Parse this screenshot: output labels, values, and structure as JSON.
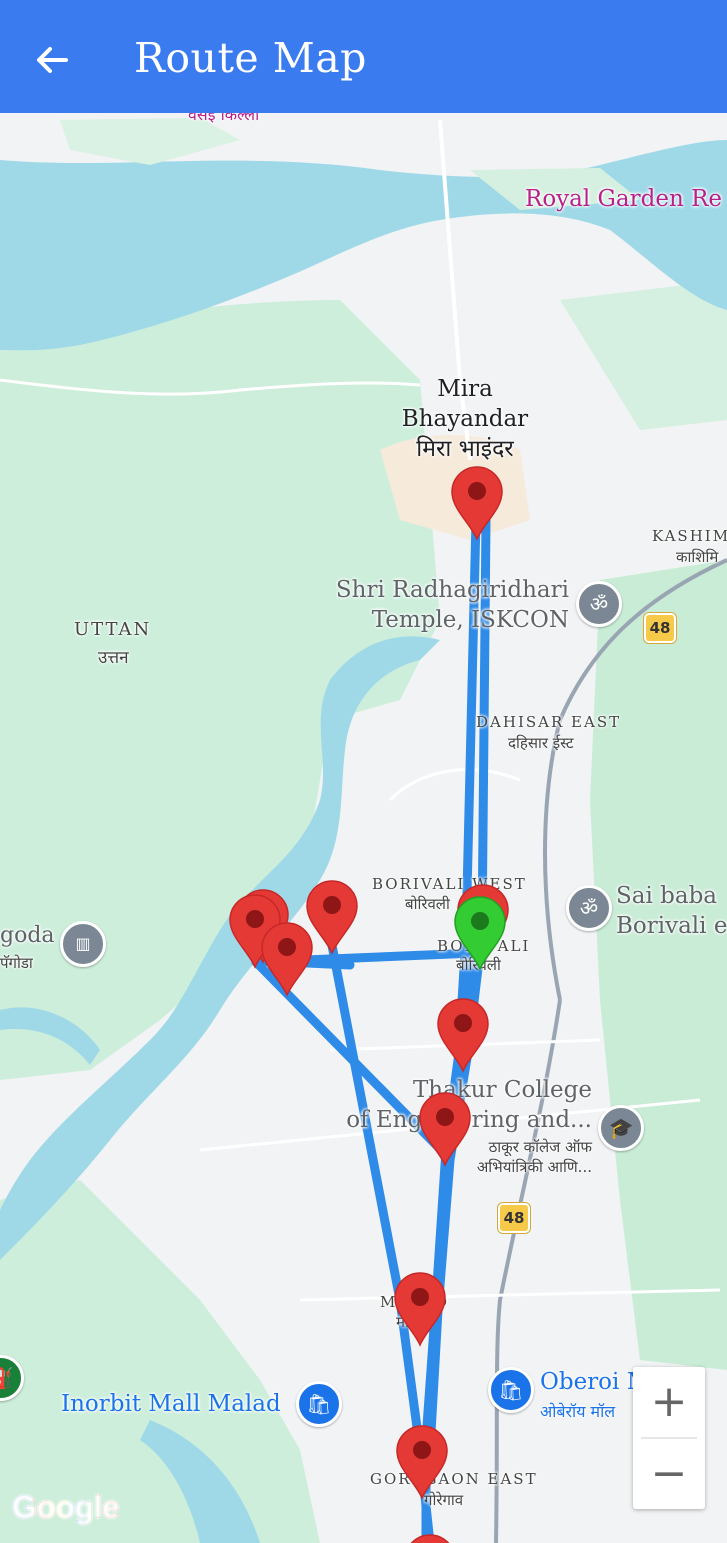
{
  "appbar": {
    "title": "Route Map",
    "back_icon": "arrow-back-icon"
  },
  "map": {
    "labels": {
      "mira_en_1": "Mira",
      "mira_en_2": "Bhayandar",
      "mira_hi": "मिरा भाइंदर",
      "top_hi": "वसई किल्ला",
      "royal_garden": "Royal Garden Re",
      "kashim_en": "KASHIM",
      "kashim_hi": "काशिमि",
      "iskcon_1": "Shri Radhagiridhari",
      "iskcon_2": "Temple, ISKCON",
      "uttan_en": "UTTAN",
      "uttan_hi": "उत्तन",
      "dahisar_en": "DAHISAR EAST",
      "dahisar_hi": "दहिसार ईस्ट",
      "borivali_west_en": "BORIVALI WEST",
      "borivali_west_hi": "बोरिवली",
      "borivali_en": "BORIVALI",
      "borivali_hi": "बोरिवली",
      "sai_baba_1": "Sai baba",
      "sai_baba_2": "Borivali e",
      "pagoda_en": "goda",
      "pagoda_hi": "पॅगोडा",
      "thakur_1": "Thakur College",
      "thakur_2": "of Engineering and...",
      "thakur_hi_1": "ठाकूर कॉलेज ऑफ",
      "thakur_hi_2": "अभियांत्रिकी आणि...",
      "malad_en": "MALAD",
      "malad_hi": "मालाड",
      "inorbit": "Inorbit Mall Malad",
      "oberoi_en": "Oberoi Mall",
      "oberoi_hi": "ओबेरॉय मॉल",
      "goregaon_en": "GOREGAON EAST",
      "goregaon_hi": "गोरेगाव",
      "shield_1": "48",
      "shield_2": "48"
    },
    "icons": {
      "iskcon": "om-temple-icon",
      "sai_baba": "om-temple-icon",
      "pagoda": "monument-icon",
      "thakur": "graduation-cap-icon",
      "inorbit": "shopping-bag-icon",
      "oberoi": "shopping-bag-icon"
    },
    "colors": {
      "route": "#2e8be8",
      "pin_red": "#e53935",
      "pin_green": "#33cc33",
      "water": "#9fd9e8",
      "park": "#c9ecd6",
      "land": "#f1f3f4"
    }
  },
  "zoom": {
    "in_label": "+",
    "out_label": "−"
  },
  "attribution": {
    "google_logo": "Google"
  }
}
